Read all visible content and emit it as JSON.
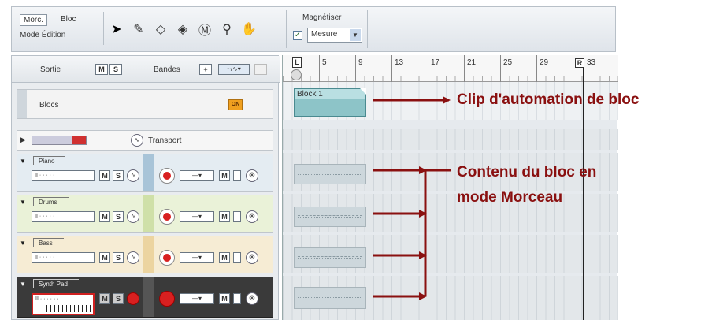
{
  "toolbar": {
    "mode_button": "Morc.",
    "bloc_label": "Bloc",
    "mode_edition_label": "Mode Édition",
    "tools": [
      {
        "icon": "arrow-icon",
        "glyph": "➤"
      },
      {
        "icon": "pencil-icon",
        "glyph": "✎"
      },
      {
        "icon": "eraser-icon",
        "glyph": "◇"
      },
      {
        "icon": "paint-icon",
        "glyph": "◈"
      },
      {
        "icon": "mute-tool-icon",
        "glyph": "Ⓜ"
      },
      {
        "icon": "magnify-icon",
        "glyph": "⚲"
      },
      {
        "icon": "hand-icon",
        "glyph": "✋"
      }
    ],
    "magnet_title": "Magnétiser",
    "magnet_checked": "✓",
    "magnet_value": "Mesure",
    "magnet_arrow": "▼"
  },
  "tracklist": {
    "sortie_label": "Sortie",
    "m_label": "M",
    "s_label": "S",
    "bandes_label": "Bandes",
    "bandes_plus": "+",
    "bandes_select": "~/∿▾",
    "blocs_label": "Blocs",
    "on_label": "ON",
    "transport_label": "Transport",
    "transport_icon": "∿",
    "tracks": [
      {
        "name": "Piano",
        "slot": "II · · · · · ·",
        "rec_dd": "—▾",
        "x": "⊗"
      },
      {
        "name": "Drums",
        "slot": "II · · · · · ·",
        "rec_dd": "—▾",
        "x": "⊗"
      },
      {
        "name": "Bass",
        "slot": "II · · · · · ·",
        "rec_dd": "—▾",
        "x": "⊗"
      },
      {
        "name": "Synth Pad",
        "slot": "II · · · · · ·",
        "rec_dd": "—▾",
        "x": "⊗"
      }
    ]
  },
  "ruler": {
    "bars": [
      "5",
      "9",
      "13",
      "17",
      "21",
      "25",
      "29",
      "33"
    ],
    "left_locator": "L",
    "right_locator": "R"
  },
  "arrange": {
    "block_clip_name": "Block 1"
  },
  "annotations": {
    "clip_automation": "Clip d'automation de bloc",
    "content_line1": "Contenu du bloc en",
    "content_line2": "mode Morceau"
  },
  "colors": {
    "annotation": "#8a1010",
    "block_clip": "#8dc4c8",
    "record": "#d82020"
  }
}
